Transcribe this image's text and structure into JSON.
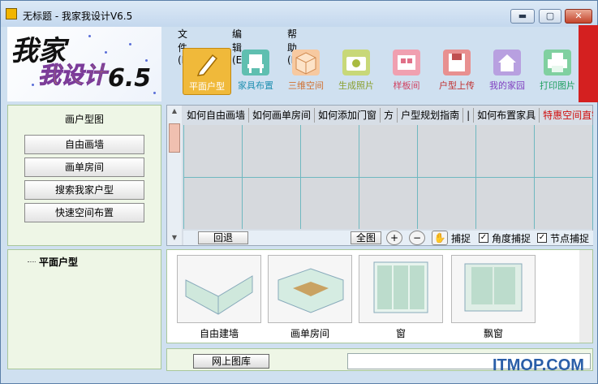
{
  "window": {
    "title": "无标题 - 我家我设计V6.5",
    "min_label": "▬",
    "max_label": "▢",
    "close_label": "✕"
  },
  "logo": {
    "line1": "我家",
    "line2": "我设计",
    "version": "6.5"
  },
  "menu": [
    "文件(F)",
    "编辑(E)",
    "帮助(H)"
  ],
  "toolbar": [
    {
      "label": "平面户型",
      "icon": "pencil-icon"
    },
    {
      "label": "家具布置",
      "icon": "chair-icon"
    },
    {
      "label": "三维空间",
      "icon": "cube-icon"
    },
    {
      "label": "生成照片",
      "icon": "camera-icon"
    },
    {
      "label": "样板间",
      "icon": "room-icon"
    },
    {
      "label": "户型上传",
      "icon": "floppy-icon"
    },
    {
      "label": "我的家园",
      "icon": "home-icon"
    },
    {
      "label": "打印图片",
      "icon": "printer-icon"
    }
  ],
  "sidebar": {
    "group_title": "画户型图",
    "buttons": [
      "自由画墙",
      "画单房间",
      "搜索我家户型",
      "快速空间布置"
    ]
  },
  "tabs": [
    "如何自由画墙",
    "如何画单房间",
    "如何添加门窗",
    "方",
    "户型规划指南",
    "|",
    "如何布置家具",
    "特惠空间直销"
  ],
  "canvas_toolbar": {
    "back": "回退",
    "fit": "全图",
    "zoom_in": "+",
    "zoom_out": "−",
    "hand": "✋",
    "snap1": "捕捉",
    "snap2": "角度捕捉",
    "snap3": "节点捕捉"
  },
  "tree": {
    "root": "平面户型"
  },
  "library": [
    {
      "label": "自由建墙"
    },
    {
      "label": "画单房间"
    },
    {
      "label": "窗"
    },
    {
      "label": "飘窗"
    }
  ],
  "bottom": {
    "netlib": "网上图库"
  },
  "watermark": "ITMOP.COM"
}
